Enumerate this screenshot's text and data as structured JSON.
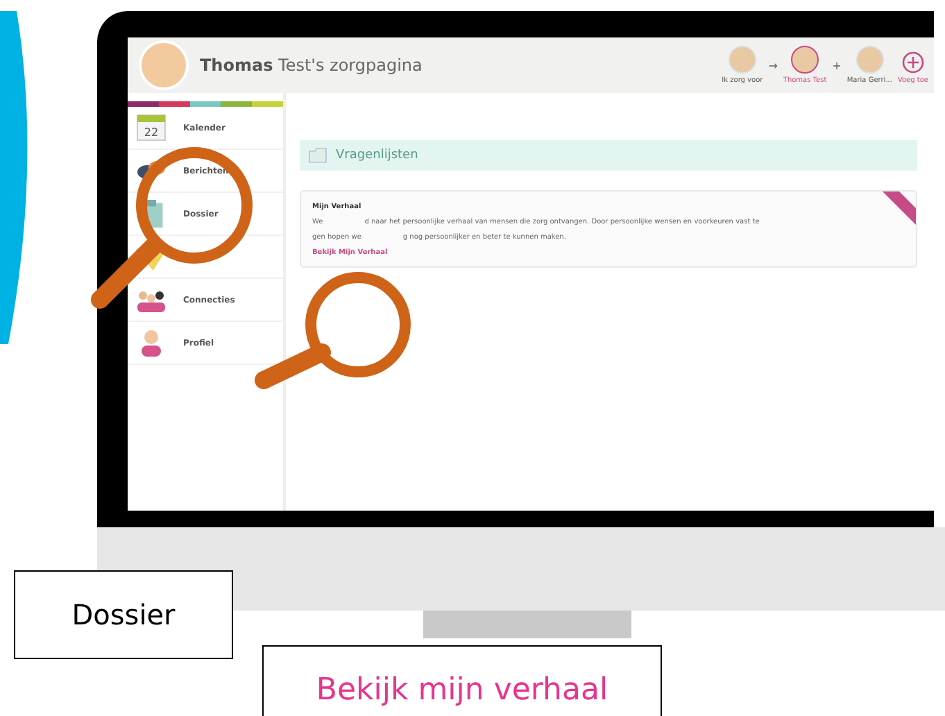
{
  "header": {
    "title_bold": "Thomas",
    "title_rest": "Test's zorgpagina",
    "care_label": "Ik zorg voor",
    "people": [
      {
        "connector": "→",
        "label": "Thomas Test",
        "selected": true
      },
      {
        "connector": "+",
        "label": "Maria Gerri...",
        "selected": false
      }
    ],
    "add_label": "Voeg toe"
  },
  "sidebar": {
    "items": [
      {
        "kind": "calendar",
        "label": "Kalender",
        "day": "22"
      },
      {
        "kind": "messages",
        "label": "Berichten"
      },
      {
        "kind": "dossier",
        "label": "Dossier"
      },
      {
        "kind": "notes"
      },
      {
        "kind": "connections",
        "label": "Connecties"
      },
      {
        "kind": "profile",
        "label": "Profiel"
      }
    ]
  },
  "section": {
    "title": "Vragenlijsten"
  },
  "card": {
    "title": "Mijn Verhaal",
    "line_1": [
      "We",
      "d naar het persoonlijke verhaal van mensen die zorg ontvangen. Door persoonlijke wensen en voorkeuren vast te"
    ],
    "line_2": [
      "gen hopen we",
      "g nog persoonlijker en beter te kunnen maken."
    ],
    "link": "Bekijk Mijn Verhaal"
  },
  "callouts": [
    {
      "label": "Dossier",
      "kind": "plain"
    },
    {
      "label": "Bekijk mijn verhaal",
      "kind": "link"
    }
  ]
}
